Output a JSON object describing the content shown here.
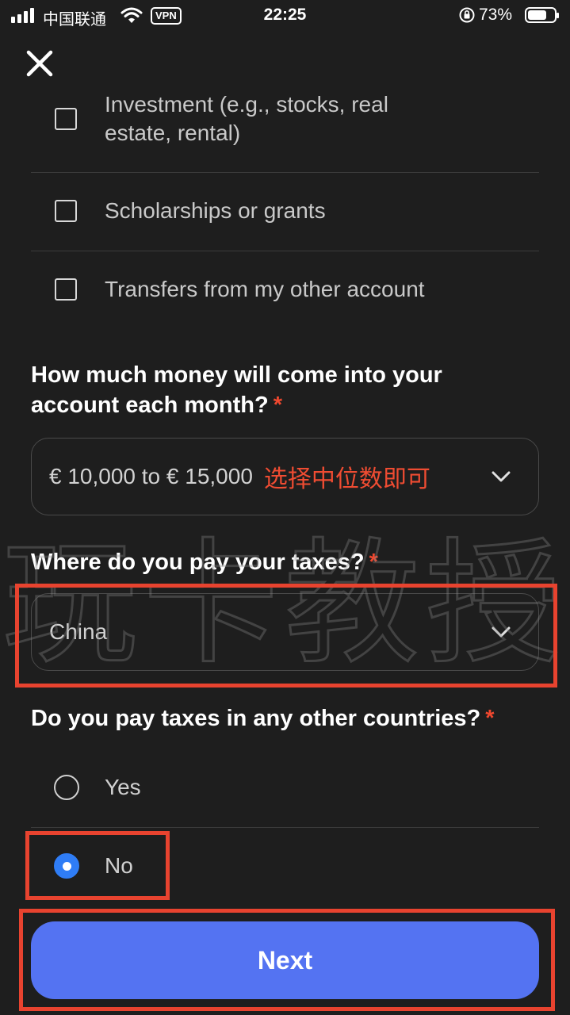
{
  "status_bar": {
    "carrier": "中国联通",
    "vpn": "VPN",
    "time": "22:25",
    "battery": "73%",
    "battery_level": 0.73,
    "icons": [
      "signal-icon",
      "wifi-icon",
      "orientation-lock-icon",
      "battery-icon"
    ]
  },
  "close_icon": "close-icon",
  "income_sources": [
    {
      "label": "Investment (e.g., stocks, real estate, rental)",
      "checked": false
    },
    {
      "label": "Scholarships or grants",
      "checked": false
    },
    {
      "label": "Transfers from my other account",
      "checked": false
    }
  ],
  "monthly_question": {
    "text": "How much money will come into your account each month?",
    "required": "*"
  },
  "monthly_select": {
    "value": "€ 10,000 to € 15,000",
    "note": "选择中位数即可",
    "icon": "chevron-down-icon"
  },
  "tax_question": {
    "text": "Where do you pay your taxes?",
    "required": "*"
  },
  "tax_select": {
    "value": "China",
    "icon": "chevron-down-icon"
  },
  "other_tax_question": {
    "text": "Do you pay taxes in any other countries?",
    "required": "*"
  },
  "other_tax_options": [
    {
      "label": "Yes",
      "selected": false
    },
    {
      "label": "No",
      "selected": true
    }
  ],
  "next_button": "Next",
  "watermark": "玩卡教授",
  "colors": {
    "background": "#1e1e1e",
    "accent": "#5473f2",
    "radio_selected": "#2f7df6",
    "required": "#f0482f",
    "annotation": "#e8432f"
  }
}
